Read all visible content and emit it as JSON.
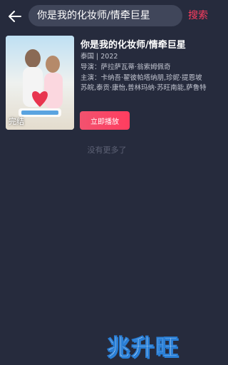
{
  "search": {
    "query": "你是我的化妆师/情牵巨星",
    "button_label": "搜索"
  },
  "result": {
    "title": "你是我的化妆师/情牵巨星",
    "meta": "泰国 | 2022",
    "director": "导演：萨拉萨瓦蒂·翁索姆佩奇",
    "cast": "主演：卡纳吾·翟彼帕塔纳朋,珍妮·提恩坡",
    "cast_cont": "苏皖,泰贡·康怡,普林玛纳·苏旺南能,萨鲁特",
    "status_badge": "完结",
    "play_label": "立即播放"
  },
  "footer": {
    "no_more": "没有更多了"
  },
  "watermark": "兆升旺",
  "colors": {
    "background": "#262b3d",
    "accent": "#ff3d5f"
  }
}
